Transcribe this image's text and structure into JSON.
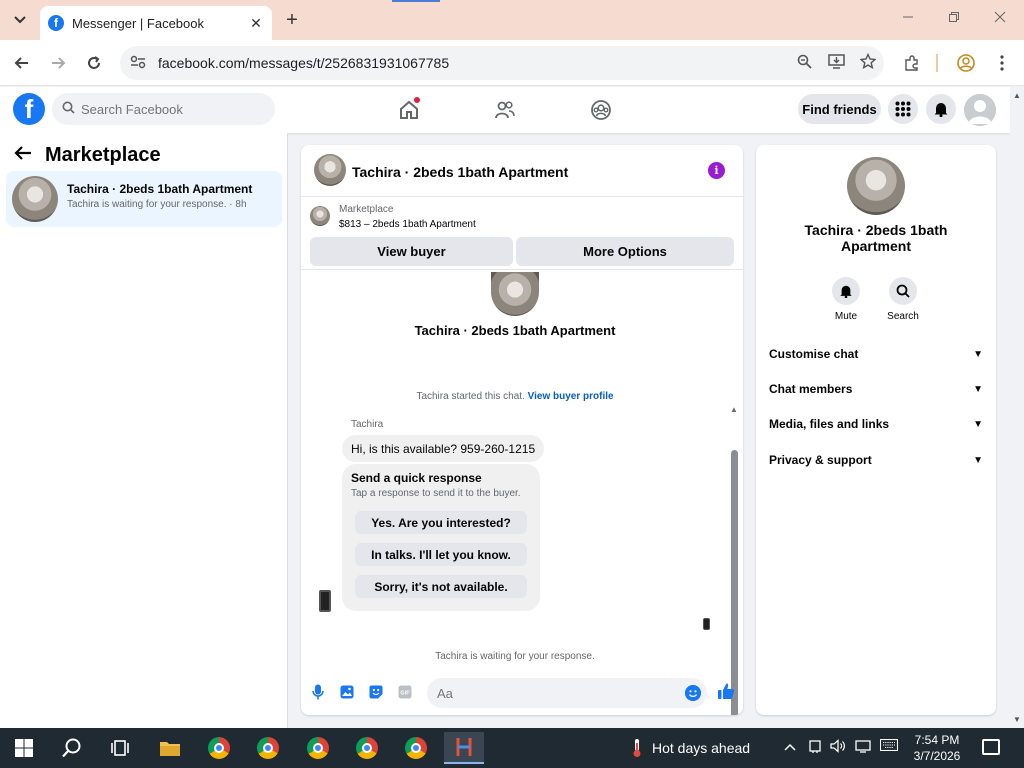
{
  "browser": {
    "tab_title": "Messenger | Facebook",
    "tab_close": "✕",
    "new_tab": "+",
    "url": "facebook.com/messages/t/2526831931067785"
  },
  "fb": {
    "logo": "f",
    "search_placeholder": "Search Facebook",
    "find_friends": "Find friends"
  },
  "left": {
    "title": "Marketplace",
    "conversation": {
      "name": "Tachira · 2beds 1bath Apartment",
      "preview": "Tachira is waiting for your response. · 8h"
    }
  },
  "chat": {
    "header_name": "Tachira · 2beds 1bath Apartment",
    "info_glyph": "i",
    "marketplace_label": "Marketplace",
    "listing": "$813 – 2beds 1bath Apartment",
    "view_buyer": "View buyer",
    "more_options": "More Options",
    "center_name": "Tachira · 2beds 1bath Apartment",
    "started_text": "Tachira started this chat.",
    "started_link": "View buyer profile",
    "sender": "Tachira",
    "message": "Hi, is this available? 959-260-1215",
    "quick_title": "Send a quick response",
    "quick_sub": "Tap a response to send it to the buyer.",
    "quick_responses": [
      "Yes. Are you interested?",
      "In talks. I'll let you know.",
      "Sorry, it's not available."
    ],
    "waiting": "Tachira is waiting for your response.",
    "composer_placeholder": "Aa",
    "gif_label": "GIF"
  },
  "right": {
    "name": "Tachira · 2beds 1bath Apartment",
    "mute": "Mute",
    "search": "Search",
    "sections": [
      "Customise chat",
      "Chat members",
      "Media, files and links",
      "Privacy & support"
    ]
  },
  "taskbar": {
    "weather": "Hot days ahead",
    "time": "7:54 PM",
    "date": "3/7/2026"
  },
  "colors": {
    "fb_blue": "#1877f2",
    "selected_bg": "#ebf5ff",
    "info_purple": "#9b1bd4"
  }
}
